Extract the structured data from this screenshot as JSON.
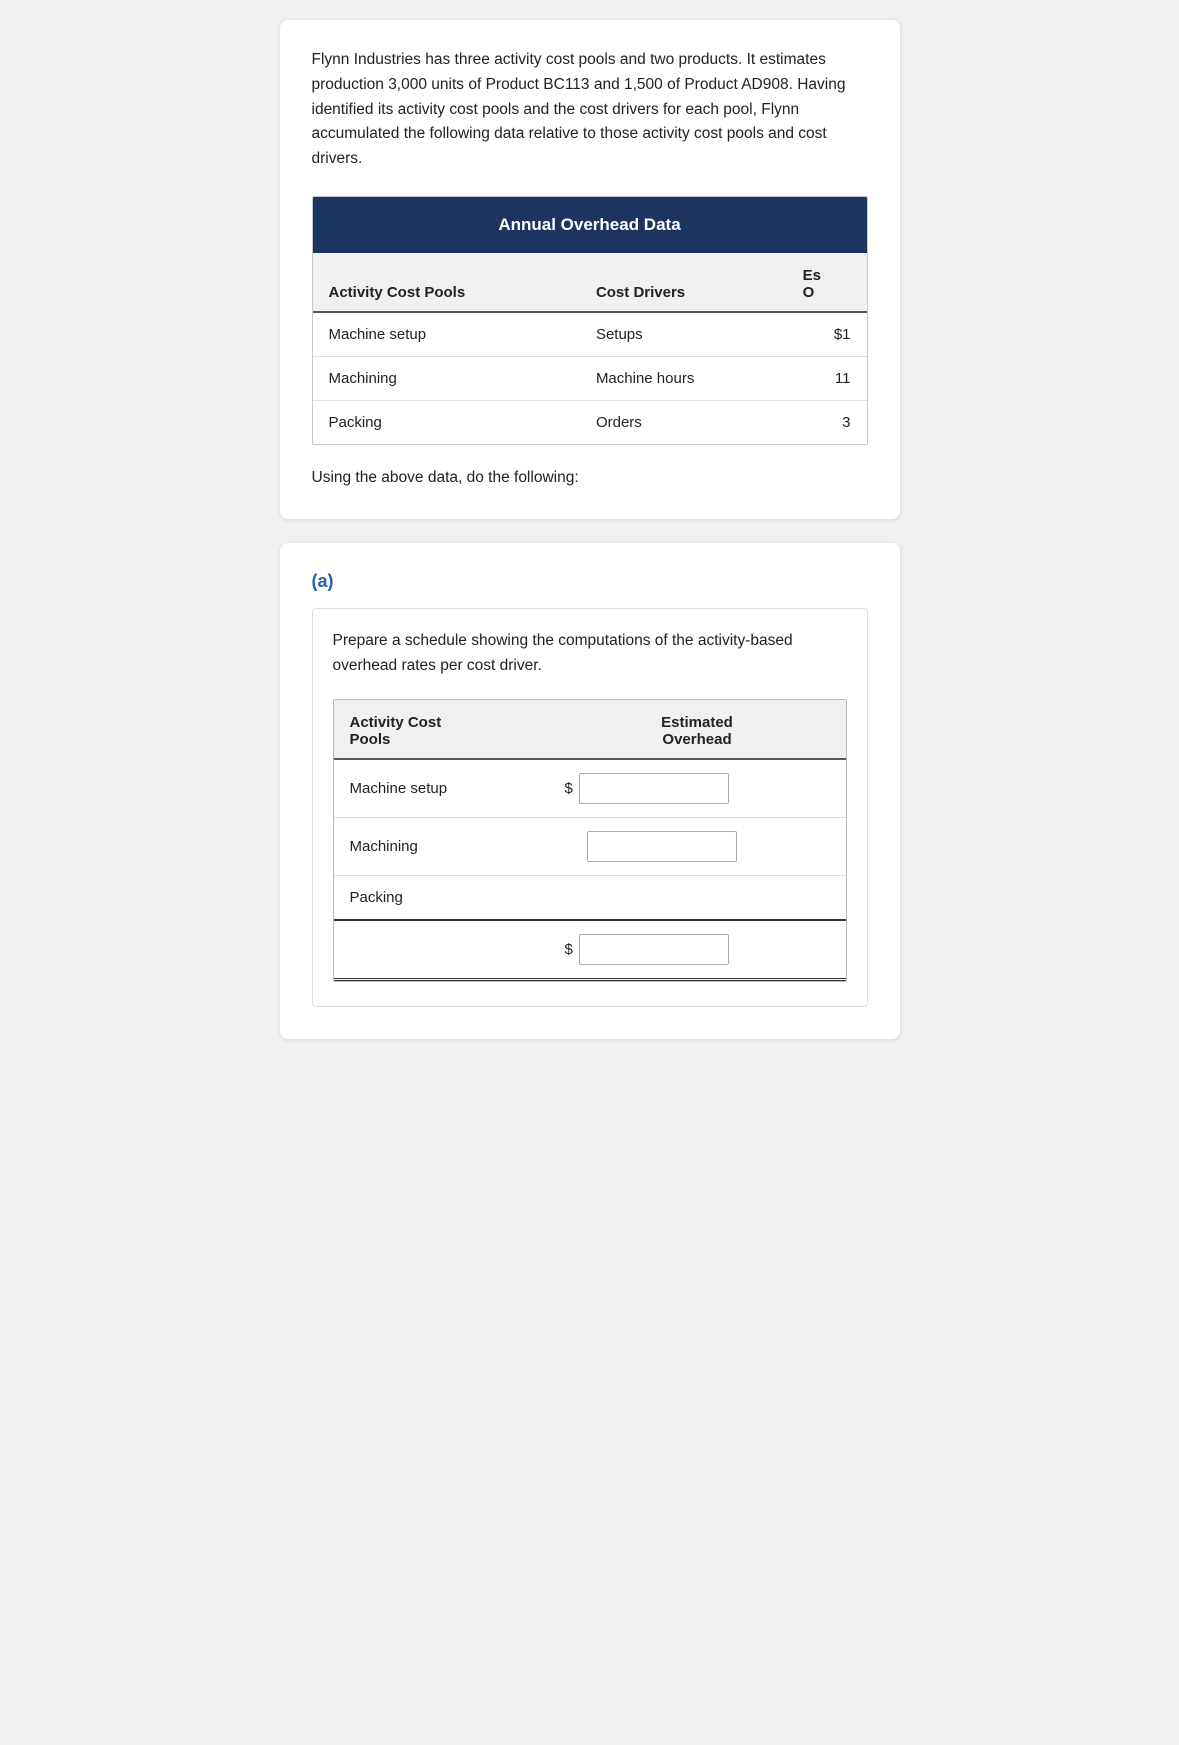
{
  "intro": {
    "text": "Flynn Industries has three activity cost pools and two products. It estimates production 3,000 units of Product BC113 and 1,500 of Product AD908. Having identified its activity cost pools and the cost drivers for each pool, Flynn accumulated the following data relative to those activity cost pools and cost drivers."
  },
  "annual_table": {
    "title": "Annual Overhead Data",
    "columns": {
      "col1": "Activity Cost Pools",
      "col2": "Cost Drivers",
      "col3_partial": "Es\nO"
    },
    "rows": [
      {
        "pool": "Machine setup",
        "driver": "Setups",
        "estimated": "$1"
      },
      {
        "pool": "Machining",
        "driver": "Machine hours",
        "estimated": "11"
      },
      {
        "pool": "Packing",
        "driver": "Orders",
        "estimated": "3"
      }
    ]
  },
  "using_text": "Using the above data, do the following:",
  "part_a": {
    "label": "(a)",
    "prepare_text": "Prepare a schedule showing the computations of the activity-based overhead rates per cost driver.",
    "table": {
      "col1": "Activity Cost\nPools",
      "col2_line1": "Estimated",
      "col2_line2": "Overhead",
      "rows": [
        {
          "pool": "Machine setup",
          "has_dollar": true,
          "value": ""
        },
        {
          "pool": "Machining",
          "has_dollar": false,
          "value": ""
        },
        {
          "pool": "Packing",
          "has_dollar": false,
          "value": ""
        }
      ],
      "total_dollar": "$",
      "total_value": ""
    }
  }
}
